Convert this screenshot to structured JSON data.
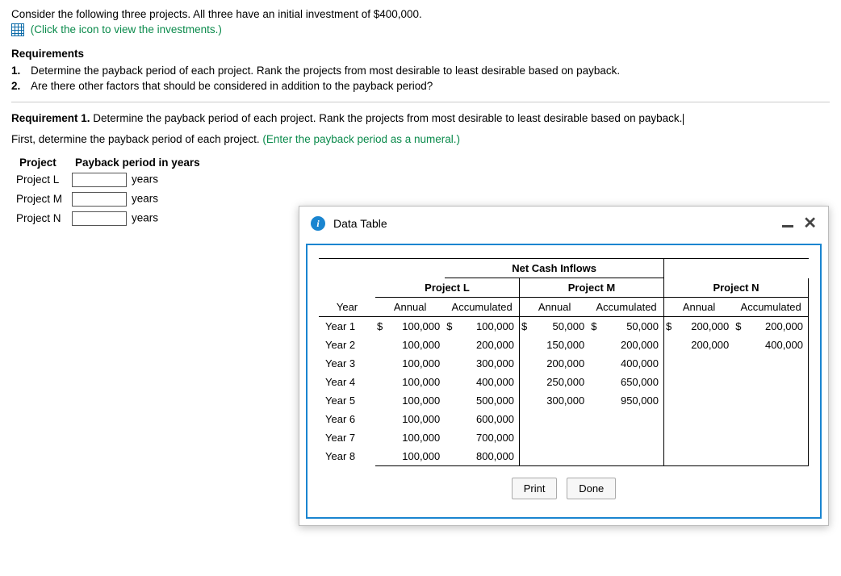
{
  "intro": "Consider the following three projects. All three have an initial investment of $400,000.",
  "link": "(Click the icon to view the investments.)",
  "req_heading": "Requirements",
  "requirements": [
    "Determine the payback period of each project. Rank the projects from most desirable to least desirable based on payback.",
    "Are there other factors that should be considered in addition to the payback period?"
  ],
  "req1_lead": "Requirement 1.",
  "req1_text": " Determine the payback period of each project. Rank the projects from most desirable to least desirable based on payback.",
  "instr2_a": "First, determine the payback period of each project. ",
  "instr2_b": "(Enter the payback period as a numeral.)",
  "pb": {
    "col_project": "Project",
    "col_period": "Payback period in years",
    "rows": [
      {
        "name": "Project L",
        "unit": "years"
      },
      {
        "name": "Project M",
        "unit": "years"
      },
      {
        "name": "Project N",
        "unit": "years"
      }
    ]
  },
  "modal": {
    "title": "Data Table",
    "super_header": "Net Cash Inflows",
    "projects": [
      "Project L",
      "Project M",
      "Project N"
    ],
    "subcols": [
      "Year",
      "Annual",
      "Accumulated",
      "Annual",
      "Accumulated",
      "Annual",
      "Accumulated"
    ],
    "years": [
      "Year 1",
      "Year 2",
      "Year 3",
      "Year 4",
      "Year 5",
      "Year 6",
      "Year 7",
      "Year 8"
    ],
    "print": "Print",
    "done": "Done"
  },
  "chart_data": {
    "type": "table",
    "title": "Net Cash Inflows",
    "year_labels": [
      "Year 1",
      "Year 2",
      "Year 3",
      "Year 4",
      "Year 5",
      "Year 6",
      "Year 7",
      "Year 8"
    ],
    "projects": {
      "Project L": {
        "annual": [
          100000,
          100000,
          100000,
          100000,
          100000,
          100000,
          100000,
          100000
        ],
        "accumulated": [
          100000,
          200000,
          300000,
          400000,
          500000,
          600000,
          700000,
          800000
        ]
      },
      "Project M": {
        "annual": [
          50000,
          150000,
          200000,
          250000,
          300000,
          null,
          null,
          null
        ],
        "accumulated": [
          50000,
          200000,
          400000,
          650000,
          950000,
          null,
          null,
          null
        ]
      },
      "Project N": {
        "annual": [
          200000,
          200000,
          null,
          null,
          null,
          null,
          null,
          null
        ],
        "accumulated": [
          200000,
          400000,
          null,
          null,
          null,
          null,
          null,
          null
        ]
      }
    },
    "display": {
      "L": {
        "annual": [
          "100,000",
          "100,000",
          "100,000",
          "100,000",
          "100,000",
          "100,000",
          "100,000",
          "100,000"
        ],
        "acc": [
          "100,000",
          "200,000",
          "300,000",
          "400,000",
          "500,000",
          "600,000",
          "700,000",
          "800,000"
        ]
      },
      "M": {
        "annual": [
          "50,000",
          "150,000",
          "200,000",
          "250,000",
          "300,000",
          "",
          "",
          ""
        ],
        "acc": [
          "50,000",
          "200,000",
          "400,000",
          "650,000",
          "950,000",
          "",
          "",
          ""
        ]
      },
      "N": {
        "annual": [
          "200,000",
          "200,000",
          "",
          "",
          "",
          "",
          "",
          ""
        ],
        "acc": [
          "200,000",
          "400,000",
          "",
          "",
          "",
          "",
          "",
          ""
        ]
      }
    }
  }
}
